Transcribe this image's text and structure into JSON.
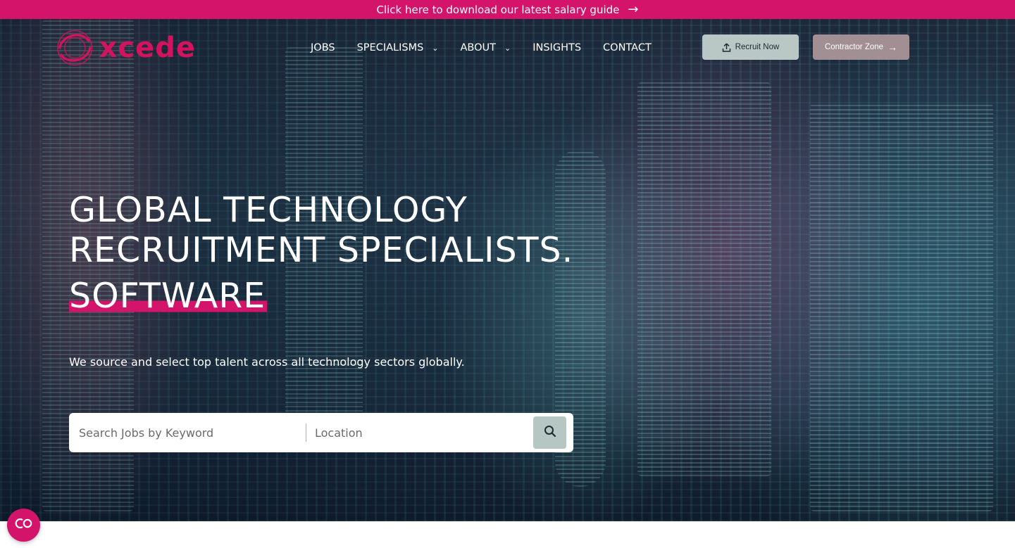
{
  "promo": {
    "text": "Click here to download our latest salary guide",
    "arrow_icon": "arrow-right-icon"
  },
  "brand": {
    "logo_text": "xcede",
    "color": "#d4135f"
  },
  "nav": {
    "items": [
      {
        "label": "JOBS"
      },
      {
        "label": "SPECIALISMS",
        "has_dropdown": true
      },
      {
        "label": "ABOUT",
        "has_dropdown": true
      },
      {
        "label": "INSIGHTS"
      },
      {
        "label": "CONTACT"
      }
    ]
  },
  "actions": {
    "recruit_label": "Recruit Now",
    "recruit_icon": "upload-icon",
    "contractor_label": "Contractor Zone",
    "contractor_icon": "arrow-right-icon"
  },
  "hero": {
    "headline_line1": "GLOBAL TECHNOLOGY",
    "headline_line2": "RECRUITMENT SPECIALISTS.",
    "rotating_word": "SOFTWARE",
    "subtitle": "We source and select top talent across all technology sectors globally."
  },
  "search": {
    "keyword_placeholder": "Search Jobs by Keyword",
    "location_placeholder": "Location",
    "submit_icon": "search-icon"
  },
  "chat": {
    "icon": "chat-logo-icon"
  },
  "colors": {
    "accent": "#d4136b",
    "recruit_button": "#b9c8c4",
    "contractor_button": "#a28f93",
    "search_button": "#b6c6c2"
  }
}
